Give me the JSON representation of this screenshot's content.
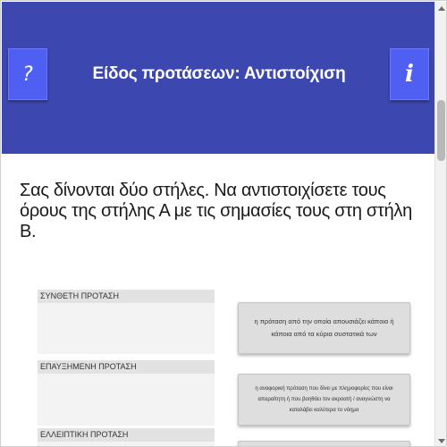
{
  "header": {
    "title": "Είδος προτάσεων: Αντιστοίχιση",
    "help_label": "?",
    "info_label": "i",
    "background_color": "#3c48b0",
    "button_color": "#4f5ff2"
  },
  "instructions": "Σας δίνονται δύο στήλες. Να αντιστοιχίσετε τους όρους της στήλης Α με τις σημασίες τους στη στήλη Β.",
  "terms": [
    {
      "label": "ΣΥΝΘΕΤΗ ΠΡΟΤΑΣΗ"
    },
    {
      "label": "ΕΠΑΥΞΗΜΕΝΗ ΠΡΟΤΑΣΗ"
    },
    {
      "label": "ΕΛΛΕΙΠΤΙΚΗ ΠΡΟΤΑΣΗ"
    }
  ],
  "answers": [
    {
      "text": "η πρόταση από την οποία απουσιάζει κάποιο ή κάποια από τα κύρια συστατικά των"
    },
    {
      "text": "η αναφορική πρόταση που δίνει με πληροφορίες που είναι απαραίτητη ή που βοηθάει τον ακροατή / αναγνώστη να καταλάβει καλύτερα το νόημα"
    },
    {
      "text": ""
    }
  ],
  "scrollbar": {
    "icons": [
      "scroll-up-arrow-icon",
      "scroll-down-arrow-icon"
    ]
  }
}
